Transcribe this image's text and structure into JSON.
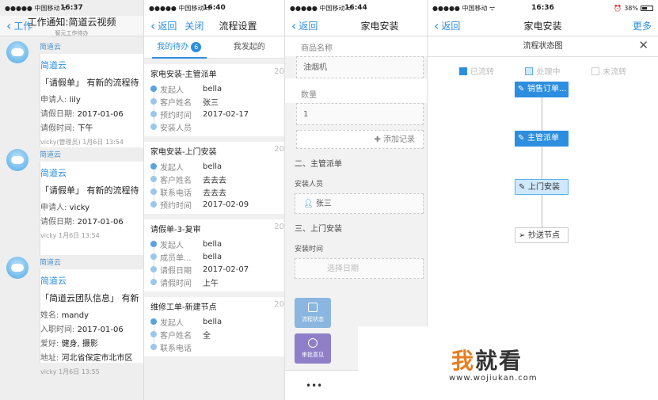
{
  "status": {
    "carrier": "●●●●● 中国移动 ᯤ",
    "battery": "38%"
  },
  "p1": {
    "time": "16:37",
    "back": "工作",
    "title": "工作通知:简道云视频",
    "subtitle": "智元工作待办",
    "messages": [
      {
        "sender": "简道云",
        "card_title": "简道云",
        "summary": "「请假单」 有新的流程待",
        "lines": [
          [
            "申请人: ",
            "lily"
          ],
          [
            "请假日期: ",
            "2017-01-06"
          ],
          [
            "请假时间: ",
            "下午"
          ]
        ],
        "footer": "vicky(管理员) 1月6日 13:54"
      },
      {
        "sender": "简道云",
        "card_title": "简道云",
        "summary": "「请假单」 有新的流程待",
        "lines": [
          [
            "申请人: ",
            "vicky"
          ],
          [
            "请假日期: ",
            "2017-01-06"
          ]
        ],
        "footer": "vicky 1月6日 13:54"
      },
      {
        "sender": "简道云",
        "card_title": "简道云",
        "summary": "「简道云团队信息」 有新",
        "lines": [
          [
            "姓名: ",
            "mandy"
          ],
          [
            "入职时间: ",
            "2017-01-06"
          ],
          [
            "爱好: ",
            "健身, 摄影"
          ],
          [
            "地址: ",
            "河北省保定市北市区"
          ]
        ],
        "footer": "vicky 1月6日 13:55"
      }
    ]
  },
  "p2": {
    "time": "16:40",
    "back": "返回",
    "close": "关闭",
    "title": "流程设置",
    "tab_todo": "我的待办",
    "tab_todo_count": "6",
    "tab_mine": "我发起的",
    "tasks": [
      {
        "title": "家电安装-主管派单",
        "num": "20",
        "rows": [
          [
            "发起人",
            "bella"
          ],
          [
            "客户姓名",
            "张三"
          ],
          [
            "预约时间",
            "2017-02-17"
          ],
          [
            "安装人员",
            ""
          ]
        ]
      },
      {
        "title": "家电安装-上门安装",
        "num": "20",
        "rows": [
          [
            "发起人",
            "bella"
          ],
          [
            "客户姓名",
            "去去去"
          ],
          [
            "联系电话",
            "去去去"
          ],
          [
            "预约时间",
            "2017-02-09"
          ]
        ]
      },
      {
        "title": "请假单-3-复审",
        "num": "20",
        "rows": [
          [
            "发起人",
            "bella"
          ],
          [
            "成员单...",
            "bella"
          ],
          [
            "请假日期",
            "2017-02-07"
          ],
          [
            "请假时间",
            "上午"
          ]
        ]
      },
      {
        "title": "维修工单-新建节点",
        "num": "20",
        "rows": [
          [
            "发起人",
            "bella"
          ],
          [
            "客户姓名",
            "全"
          ],
          [
            "联系电话",
            ""
          ]
        ]
      }
    ]
  },
  "p3": {
    "time": "16:44",
    "back": "返回",
    "title": "家电安装",
    "product_label": "商品名称",
    "product_value": "油烟机",
    "qty_label": "数量",
    "qty_value": "1",
    "add_record": "✚ 添加记录",
    "section2": "二、主管派单",
    "installer_label": "安装人员",
    "installer_value": "张三",
    "section3": "三、上门安装",
    "install_time_label": "安装时间",
    "date_placeholder": "选择日期",
    "fab_flow": "流程状态",
    "fab_opinion": "审批意见",
    "bottom_dots": "•••"
  },
  "p4": {
    "time": "16:36",
    "back": "返回",
    "title": "家电安装",
    "more": "更多",
    "sheet_title": "流程状态图",
    "legend": [
      "已流转",
      "处理中",
      "未流转"
    ],
    "nodes": [
      "销售订单...",
      "主管派单",
      "上门安装",
      "抄送节点"
    ],
    "colors": {
      "done": "#2d8ee0",
      "current": "#cfe8fb",
      "todo": "#ffffff"
    }
  },
  "watermark": {
    "logo": "我就看",
    "url": "www.wojiukan.com"
  }
}
